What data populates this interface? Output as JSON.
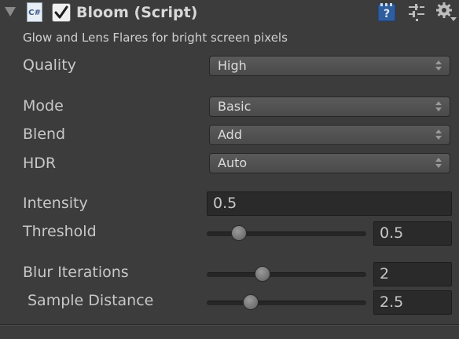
{
  "component": {
    "title": "Bloom (Script)",
    "script_icon_text": "C#",
    "enabled": true,
    "description": "Glow and Lens Flares for bright screen pixels"
  },
  "header_icons": [
    "help-icon",
    "preset-icon",
    "gear-icon"
  ],
  "properties": {
    "quality": {
      "label": "Quality",
      "value": "High"
    },
    "mode": {
      "label": "Mode",
      "value": "Basic"
    },
    "blend": {
      "label": "Blend",
      "value": "Add"
    },
    "hdr": {
      "label": "HDR",
      "value": "Auto"
    },
    "intensity": {
      "label": "Intensity",
      "value": "0.5"
    },
    "threshold": {
      "label": "Threshold",
      "value": "0.5",
      "slider_fraction": 0.167
    },
    "blur_iterations": {
      "label": "Blur Iterations",
      "value": "2",
      "slider_fraction": 0.333
    },
    "sample_distance": {
      "label": "Sample Distance",
      "value": "2.5",
      "slider_fraction": 0.25
    }
  },
  "colors": {
    "background": "#3c3c3c",
    "field_background": "#2a2a2a",
    "popup_background": "#505050",
    "text": "#c8c8c8"
  }
}
